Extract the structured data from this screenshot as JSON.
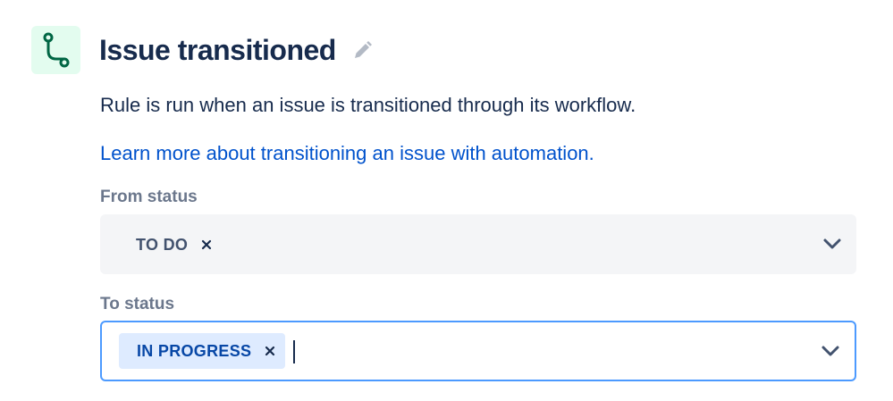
{
  "trigger": {
    "icon": "transition-path-icon",
    "title": "Issue transitioned",
    "edit_icon": "pencil-icon",
    "description": "Rule is run when an issue is transitioned through its workflow.",
    "learn_more_link": "Learn more about transitioning an issue with automation."
  },
  "from_status": {
    "label": "From status",
    "selected": [
      {
        "label": "TO DO"
      }
    ],
    "chevron_icon": "chevron-down-icon",
    "remove_icon": "close-icon"
  },
  "to_status": {
    "label": "To status",
    "selected": [
      {
        "label": "IN PROGRESS"
      }
    ],
    "chevron_icon": "chevron-down-icon",
    "remove_icon": "close-icon",
    "focused": true
  },
  "colors": {
    "icon_background": "#e3fcef",
    "icon_stroke": "#006644",
    "title_text": "#172b4d",
    "link": "#0052cc",
    "label_text": "#6b778c",
    "field_background": "#f4f5f7",
    "focus_border": "#4c9aff",
    "selected_tag_background": "#deebff",
    "selected_tag_text": "#0747a6"
  }
}
